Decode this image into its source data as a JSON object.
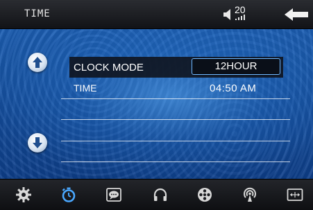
{
  "header": {
    "title": "TIME",
    "volume": "20",
    "back_icon": "back-arrow-icon"
  },
  "nav": {
    "up_icon": "arrow-up-icon",
    "down_icon": "arrow-down-icon"
  },
  "settings": {
    "clock_mode": {
      "label": "CLOCK MODE",
      "value": "12HOUR"
    },
    "time": {
      "label": "TIME",
      "value": "04:50 AM"
    }
  },
  "bottom_tabs": [
    {
      "icon": "gear-icon",
      "active": false
    },
    {
      "icon": "stopwatch-icon",
      "active": true
    },
    {
      "icon": "chat-bubble-icon",
      "active": false
    },
    {
      "icon": "headphones-icon",
      "active": false
    },
    {
      "icon": "film-reel-icon",
      "active": false
    },
    {
      "icon": "broadcast-icon",
      "active": false
    },
    {
      "icon": "screen-adjust-icon",
      "active": false
    }
  ],
  "colors": {
    "accent": "#4aa8ff",
    "background": "#1c5fb4",
    "highlight_border": "#6fb8ff"
  }
}
